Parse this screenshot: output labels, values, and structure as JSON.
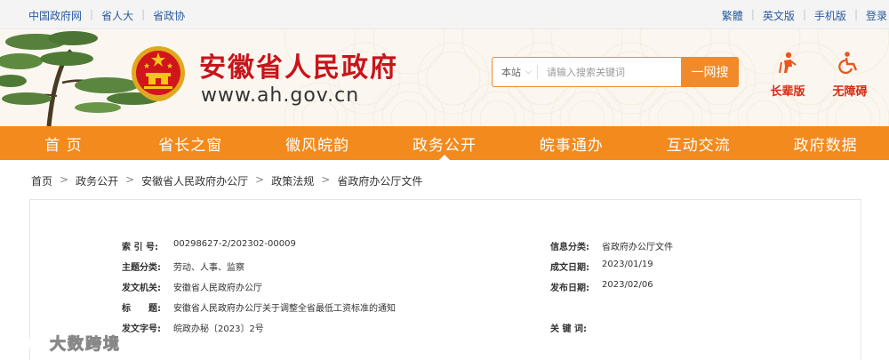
{
  "topbar": {
    "left_links": [
      "中国政府网",
      "省人大",
      "省政协"
    ],
    "right_links": [
      "繁體",
      "英文版",
      "手机版",
      "登录"
    ]
  },
  "header": {
    "site_title": "安徽省人民政府",
    "site_url": "www.ah.gov.cn",
    "search": {
      "scope": "本站",
      "placeholder": "请输入搜索关键词",
      "button": "一网搜"
    },
    "tools": {
      "elder": "长辈版",
      "accessible": "无障碍"
    }
  },
  "nav": {
    "items": [
      "首 页",
      "省长之窗",
      "徽风皖韵",
      "政务公开",
      "皖事通办",
      "互动交流",
      "政府数据"
    ],
    "active_index": 3
  },
  "breadcrumb": [
    "首页",
    "政务公开",
    "安徽省人民政府办公厅",
    "政策法规",
    "省政府办公厅文件"
  ],
  "doc_meta": {
    "index_label": "索 引 号:",
    "index_value": "00298627-2/202302-00009",
    "topic_label": "主题分类:",
    "topic_value": "劳动、人事、监察",
    "issuer_label": "发文机关:",
    "issuer_value": "安徽省人民政府办公厅",
    "title_label": "标　　题:",
    "title_value": "安徽省人民政府办公厅关于调整全省最低工资标准的通知",
    "docno_label": "发文字号:",
    "docno_value": "皖政办秘〔2023〕2号",
    "info_cat_label": "信息分类:",
    "info_cat_value": "省政府办公厅文件",
    "created_label": "成文日期:",
    "created_value": "2023/01/19",
    "published_label": "发布日期:",
    "published_value": "2023/02/06",
    "keywords_label": "关 键 词:",
    "keywords_value": ""
  },
  "watermark": "大数跨境",
  "colors": {
    "brand_orange": "#f28a1e",
    "title_red": "#c8141b",
    "link_blue": "#2a5b9e"
  }
}
